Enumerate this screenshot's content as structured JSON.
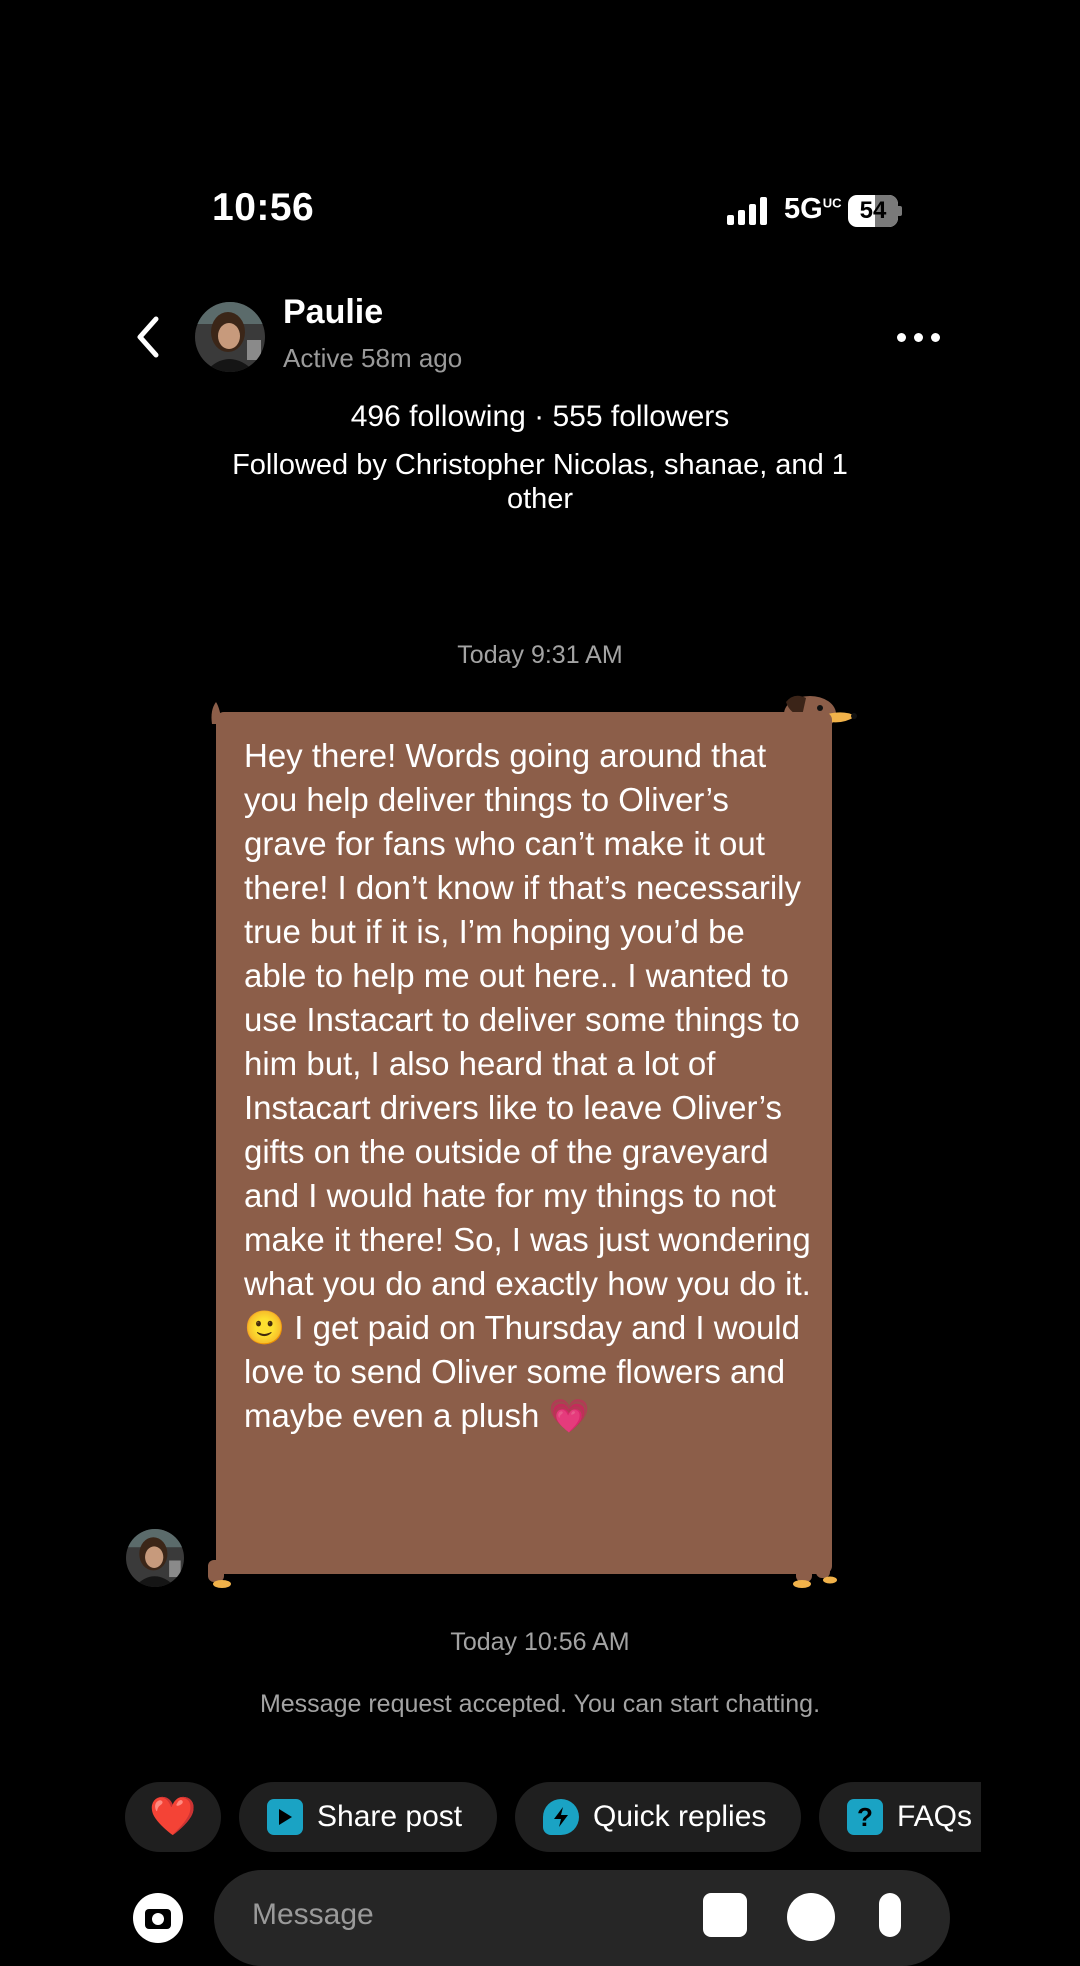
{
  "status_bar": {
    "time": "10:56",
    "network": "5G",
    "network_suffix": "UC",
    "battery": "54",
    "battery_level": 0.54
  },
  "header": {
    "name": "Paulie",
    "active": "Active 58m ago"
  },
  "profile": {
    "stats": "496 following · 555 followers",
    "followed_by": "Followed by Christopher Nicolas, shanae, and 1 other"
  },
  "conversation": {
    "timestamp_1": "Today 9:31 AM",
    "message": "Hey there! Words going around that you help deliver things to Oliver’s grave for fans who can’t make it out there! I don’t know if that’s necessarily true but if it is, I’m hoping you’d be able to help me out here.. I wanted to use Instacart to deliver some things to him but, I also heard that a lot of Instacart drivers like to leave Oliver’s gifts on the outside of the graveyard and I would hate for my things to not make it there! So, I was just wondering what you do and exactly how you do it. 🙂 I get paid on Thursday and I would love to send Oliver some flowers and maybe even a plush 💗",
    "bubble_color": "#8c5e49",
    "timestamp_2": "Today 10:56 AM",
    "request_note": "Message request accepted. You can start chatting."
  },
  "quick_actions": {
    "like_emoji": "❤️",
    "share_label": "Share post",
    "quick_label": "Quick replies",
    "faq_label": "FAQs",
    "share_color": "#1aa3c4",
    "quick_color": "#1aa3c4",
    "faq_color": "#1aa3c4"
  },
  "composer": {
    "placeholder": "Message"
  }
}
